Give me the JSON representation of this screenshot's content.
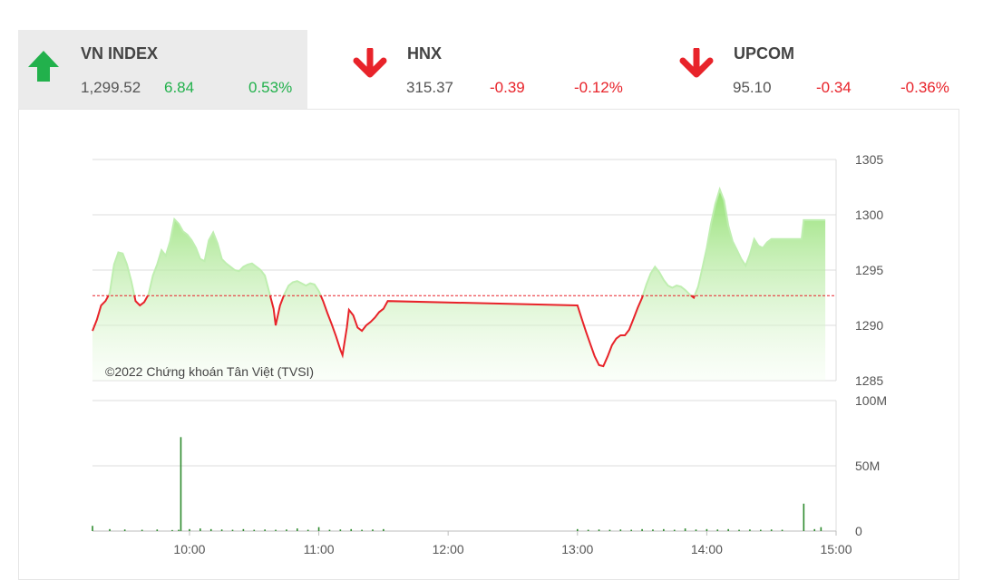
{
  "indices": [
    {
      "name": "VN INDEX",
      "value": "1,299.52",
      "change": "6.84",
      "pct": "0.53%",
      "direction": "up",
      "arrow_icon": "arrow-up-icon"
    },
    {
      "name": "HNX",
      "value": "315.37",
      "change": "-0.39",
      "pct": "-0.12%",
      "direction": "down",
      "arrow_icon": "arrow-down-icon"
    },
    {
      "name": "UPCOM",
      "value": "95.10",
      "change": "-0.34",
      "pct": "-0.36%",
      "direction": "down",
      "arrow_icon": "arrow-down-icon"
    }
  ],
  "colors": {
    "up": "#22b14c",
    "down": "#e8232a",
    "area_fill": "#a5e88a",
    "volume": "#2e8b2e",
    "reference_line": "#e8232a"
  },
  "chart_data": {
    "type": "area",
    "watermark": "©2022 Chứng khoán Tân Việt (TVSI)",
    "reference_value": 1292.68,
    "x_range": [
      "09:15",
      "15:00"
    ],
    "x_ticks": [
      "10:00",
      "11:00",
      "12:00",
      "13:00",
      "14:00",
      "15:00"
    ],
    "price": {
      "ylim": [
        1285,
        1305
      ],
      "y_ticks": [
        "1305",
        "1300",
        "1295",
        "1290",
        "1285"
      ],
      "points": [
        [
          "09:15",
          1289.5
        ],
        [
          "09:17",
          1290.5
        ],
        [
          "09:19",
          1291.8
        ],
        [
          "09:21",
          1292.2
        ],
        [
          "09:23",
          1292.9
        ],
        [
          "09:25",
          1295.5
        ],
        [
          "09:27",
          1296.6
        ],
        [
          "09:29",
          1296.5
        ],
        [
          "09:31",
          1295.5
        ],
        [
          "09:33",
          1294.0
        ],
        [
          "09:35",
          1292.2
        ],
        [
          "09:37",
          1291.8
        ],
        [
          "09:39",
          1292.1
        ],
        [
          "09:41",
          1292.8
        ],
        [
          "09:43",
          1294.5
        ],
        [
          "09:45",
          1295.5
        ],
        [
          "09:47",
          1296.8
        ],
        [
          "09:49",
          1296.3
        ],
        [
          "09:51",
          1297.6
        ],
        [
          "09:53",
          1299.6
        ],
        [
          "09:55",
          1299.2
        ],
        [
          "09:57",
          1298.5
        ],
        [
          "09:59",
          1298.2
        ],
        [
          "10:01",
          1297.7
        ],
        [
          "10:03",
          1297.0
        ],
        [
          "10:05",
          1296.0
        ],
        [
          "10:07",
          1295.8
        ],
        [
          "10:09",
          1297.7
        ],
        [
          "10:11",
          1298.4
        ],
        [
          "10:13",
          1297.4
        ],
        [
          "10:15",
          1296.0
        ],
        [
          "10:17",
          1295.6
        ],
        [
          "10:19",
          1295.3
        ],
        [
          "10:21",
          1295.0
        ],
        [
          "10:23",
          1294.9
        ],
        [
          "10:25",
          1295.3
        ],
        [
          "10:27",
          1295.5
        ],
        [
          "10:29",
          1295.6
        ],
        [
          "10:31",
          1295.3
        ],
        [
          "10:33",
          1295.0
        ],
        [
          "10:35",
          1294.5
        ],
        [
          "10:37",
          1293.0
        ],
        [
          "10:39",
          1291.5
        ],
        [
          "10:40",
          1290.0
        ],
        [
          "10:42",
          1291.8
        ],
        [
          "10:44",
          1292.8
        ],
        [
          "10:46",
          1293.6
        ],
        [
          "10:48",
          1293.9
        ],
        [
          "10:50",
          1294.0
        ],
        [
          "10:52",
          1293.8
        ],
        [
          "10:54",
          1293.6
        ],
        [
          "10:56",
          1293.8
        ],
        [
          "10:58",
          1293.7
        ],
        [
          "11:00",
          1293.1
        ],
        [
          "11:02",
          1292.2
        ],
        [
          "11:04",
          1291.1
        ],
        [
          "11:06",
          1290.1
        ],
        [
          "11:08",
          1289.0
        ],
        [
          "11:10",
          1287.8
        ],
        [
          "11:11",
          1287.3
        ],
        [
          "11:13",
          1289.8
        ],
        [
          "11:14",
          1291.4
        ],
        [
          "11:16",
          1290.9
        ],
        [
          "11:18",
          1289.8
        ],
        [
          "11:20",
          1289.5
        ],
        [
          "11:22",
          1290.0
        ],
        [
          "11:24",
          1290.3
        ],
        [
          "11:26",
          1290.7
        ],
        [
          "11:28",
          1291.2
        ],
        [
          "11:30",
          1291.5
        ],
        [
          "11:32",
          1292.2
        ],
        [
          "13:00",
          1291.8
        ],
        [
          "13:02",
          1290.6
        ],
        [
          "13:04",
          1289.4
        ],
        [
          "13:06",
          1288.3
        ],
        [
          "13:08",
          1287.2
        ],
        [
          "13:10",
          1286.4
        ],
        [
          "13:12",
          1286.3
        ],
        [
          "13:14",
          1287.2
        ],
        [
          "13:16",
          1288.2
        ],
        [
          "13:18",
          1288.8
        ],
        [
          "13:20",
          1289.1
        ],
        [
          "13:22",
          1289.1
        ],
        [
          "13:24",
          1289.6
        ],
        [
          "13:26",
          1290.6
        ],
        [
          "13:28",
          1291.6
        ],
        [
          "13:30",
          1292.5
        ],
        [
          "13:32",
          1293.7
        ],
        [
          "13:34",
          1294.7
        ],
        [
          "13:36",
          1295.3
        ],
        [
          "13:38",
          1294.8
        ],
        [
          "13:40",
          1294.1
        ],
        [
          "13:42",
          1293.6
        ],
        [
          "13:44",
          1293.4
        ],
        [
          "13:46",
          1293.6
        ],
        [
          "13:48",
          1293.5
        ],
        [
          "13:50",
          1293.2
        ],
        [
          "13:52",
          1292.8
        ],
        [
          "13:54",
          1292.5
        ],
        [
          "13:56",
          1293.5
        ],
        [
          "13:58",
          1295.2
        ],
        [
          "14:00",
          1297.0
        ],
        [
          "14:02",
          1299.2
        ],
        [
          "14:04",
          1301.0
        ],
        [
          "14:06",
          1302.3
        ],
        [
          "14:08",
          1301.3
        ],
        [
          "14:10",
          1299.0
        ],
        [
          "14:12",
          1297.6
        ],
        [
          "14:14",
          1296.8
        ],
        [
          "14:16",
          1296.0
        ],
        [
          "14:18",
          1295.4
        ],
        [
          "14:20",
          1296.4
        ],
        [
          "14:22",
          1297.8
        ],
        [
          "14:24",
          1297.2
        ],
        [
          "14:26",
          1297.0
        ],
        [
          "14:28",
          1297.5
        ],
        [
          "14:30",
          1297.8
        ],
        [
          "14:35",
          1297.8
        ],
        [
          "14:40",
          1297.8
        ],
        [
          "14:44",
          1297.8
        ],
        [
          "14:45",
          1299.52
        ],
        [
          "14:55",
          1299.52
        ]
      ]
    },
    "volume": {
      "ylim": [
        0,
        100
      ],
      "unit": "M",
      "y_ticks": [
        "100M",
        "50M",
        "0"
      ],
      "bars": [
        [
          "09:15",
          4
        ],
        [
          "09:23",
          1.5
        ],
        [
          "09:30",
          1.2
        ],
        [
          "09:38",
          1.0
        ],
        [
          "09:45",
          1.2
        ],
        [
          "09:52",
          0.8
        ],
        [
          "09:55",
          1.0
        ],
        [
          "09:56",
          72
        ],
        [
          "10:00",
          1.5
        ],
        [
          "10:05",
          2.0
        ],
        [
          "10:10",
          1.5
        ],
        [
          "10:15",
          1.2
        ],
        [
          "10:20",
          1.0
        ],
        [
          "10:25",
          1.5
        ],
        [
          "10:30",
          1.0
        ],
        [
          "10:35",
          1.2
        ],
        [
          "10:40",
          1.0
        ],
        [
          "10:45",
          1.2
        ],
        [
          "10:50",
          2.0
        ],
        [
          "10:55",
          1.0
        ],
        [
          "11:00",
          3.0
        ],
        [
          "11:05",
          1.0
        ],
        [
          "11:10",
          1.2
        ],
        [
          "11:15",
          1.5
        ],
        [
          "11:20",
          1.0
        ],
        [
          "11:25",
          1.2
        ],
        [
          "11:30",
          1.5
        ],
        [
          "13:00",
          1.5
        ],
        [
          "13:05",
          1.0
        ],
        [
          "13:10",
          1.2
        ],
        [
          "13:15",
          1.0
        ],
        [
          "13:20",
          1.2
        ],
        [
          "13:25",
          1.0
        ],
        [
          "13:30",
          1.5
        ],
        [
          "13:35",
          1.2
        ],
        [
          "13:40",
          1.5
        ],
        [
          "13:45",
          1.0
        ],
        [
          "13:50",
          2.0
        ],
        [
          "13:55",
          1.2
        ],
        [
          "14:00",
          1.5
        ],
        [
          "14:05",
          1.2
        ],
        [
          "14:10",
          1.5
        ],
        [
          "14:15",
          1.0
        ],
        [
          "14:20",
          1.2
        ],
        [
          "14:25",
          1.0
        ],
        [
          "14:30",
          1.2
        ],
        [
          "14:35",
          1.0
        ],
        [
          "14:45",
          21
        ],
        [
          "14:50",
          1.5
        ],
        [
          "14:53",
          3
        ]
      ]
    }
  }
}
